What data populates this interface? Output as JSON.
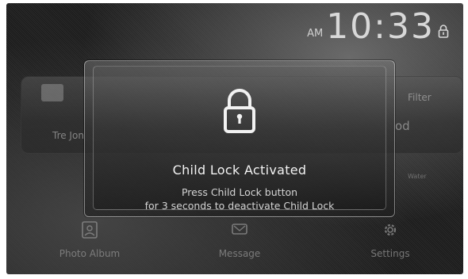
{
  "status_bar": {
    "ampm": "AM",
    "time": "10:33"
  },
  "background": {
    "line1": "Tre Jon",
    "line2": "Filter",
    "line3": "od",
    "water": "Water"
  },
  "dock": {
    "photo_album": "Photo Album",
    "message": "Message",
    "settings": "Settings"
  },
  "modal": {
    "title": "Child Lock Activated",
    "line1": "Press Child Lock button",
    "line2": "for 3 seconds to deactivate Child Lock"
  },
  "colors": {
    "text_primary": "#f3f3f3",
    "text_secondary": "#d4d4d4"
  },
  "icons": {
    "status_lock": "lock-icon",
    "modal_lock": "lock-icon"
  }
}
